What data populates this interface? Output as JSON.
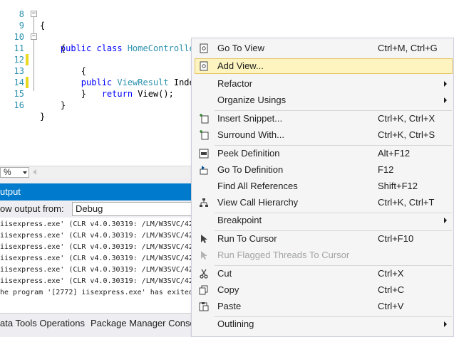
{
  "editor": {
    "lines": [
      {
        "num": "8",
        "code": "{"
      },
      {
        "num": "9",
        "code": "    public class HomeController : Controller"
      },
      {
        "num": "10",
        "code": "    {"
      },
      {
        "num": "11",
        "code": "        public ViewResult Index()"
      },
      {
        "num": "12",
        "code": "        {"
      },
      {
        "num": "13",
        "code": "            return View();"
      },
      {
        "num": "14",
        "code": "        }"
      },
      {
        "num": "15",
        "code": "    }"
      },
      {
        "num": "16",
        "code": "}"
      }
    ],
    "zoom": "%"
  },
  "output": {
    "title": "utput",
    "show_label": "ow output from:",
    "source": "Debug",
    "lines": [
      "iisexpress.exe' (CLR v4.0.30319: /LM/W3SVC/42",
      "iisexpress.exe' (CLR v4.0.30319: /LM/W3SVC/42",
      "iisexpress.exe' (CLR v4.0.30319: /LM/W3SVC/42",
      "iisexpress.exe' (CLR v4.0.30319: /LM/W3SVC/42",
      "iisexpress.exe' (CLR v4.0.30319: /LM/W3SVC/42",
      "iisexpress.exe' (CLR v4.0.30319: /LM/W3SVC/42",
      "he program '[2772] iisexpress.exe' has exited"
    ]
  },
  "tool_tabs": [
    "ata Tools Operations",
    "Package Manager Conso"
  ],
  "context_menu": {
    "items": [
      {
        "label": "Go To View",
        "shortcut": "Ctrl+M, Ctrl+G",
        "icon": "view-icon"
      },
      {
        "label": "Add View...",
        "shortcut": "",
        "icon": "add-view-icon",
        "highlighted": true
      },
      {
        "label": "Refactor",
        "shortcut": "",
        "submenu": true
      },
      {
        "label": "Organize Usings",
        "shortcut": "",
        "submenu": true
      },
      {
        "label": "Insert Snippet...",
        "shortcut": "Ctrl+K, Ctrl+X",
        "icon": "snippet-icon"
      },
      {
        "label": "Surround With...",
        "shortcut": "Ctrl+K, Ctrl+S",
        "icon": "surround-icon"
      },
      {
        "label": "Peek Definition",
        "shortcut": "Alt+F12",
        "icon": "peek-icon"
      },
      {
        "label": "Go To Definition",
        "shortcut": "F12",
        "icon": "goto-def-icon"
      },
      {
        "label": "Find All References",
        "shortcut": "Shift+F12"
      },
      {
        "label": "View Call Hierarchy",
        "shortcut": "Ctrl+K, Ctrl+T",
        "icon": "hierarchy-icon"
      },
      {
        "label": "Breakpoint",
        "shortcut": "",
        "submenu": true
      },
      {
        "label": "Run To Cursor",
        "shortcut": "Ctrl+F10",
        "icon": "cursor-icon"
      },
      {
        "label": "Run Flagged Threads To Cursor",
        "shortcut": "",
        "icon": "cursor-icon",
        "disabled": true
      },
      {
        "label": "Cut",
        "shortcut": "Ctrl+X",
        "icon": "scissors-icon"
      },
      {
        "label": "Copy",
        "shortcut": "Ctrl+C",
        "icon": "copy-icon"
      },
      {
        "label": "Paste",
        "shortcut": "Ctrl+V",
        "icon": "paste-icon"
      },
      {
        "label": "Outlining",
        "shortcut": "",
        "submenu": true
      }
    ]
  },
  "colors": {
    "accent": "#007acc",
    "highlight": "#fdf4bf",
    "keyword": "#0000ff",
    "type": "#2b91af"
  }
}
